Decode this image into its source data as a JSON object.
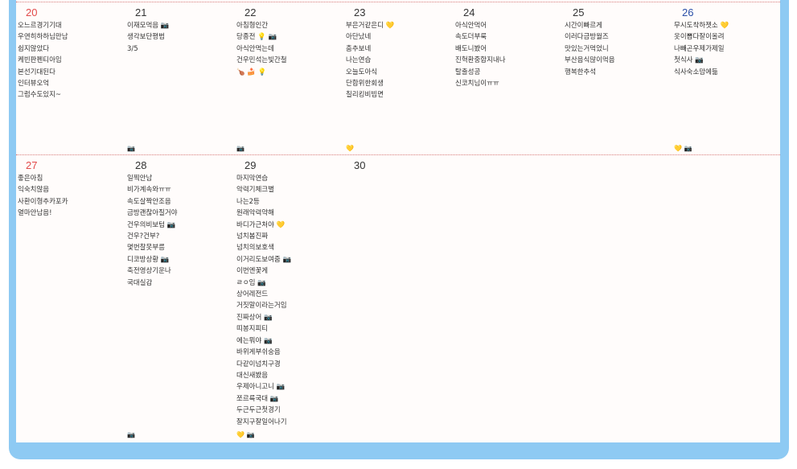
{
  "weeks": [
    {
      "days": [
        {
          "num": "20",
          "type": "sun",
          "entries": [
            "오느르경기기대",
            "우연히하하님만남",
            "쉽지않았다",
            "케빈판펜티아임",
            "본선기대된다",
            "인터뷰오억",
            "그럼수도있지~"
          ],
          "foot": []
        },
        {
          "num": "21",
          "type": "",
          "entries": [
            "이재모먹음 📷",
            "생각보단평범",
            "3/5"
          ],
          "foot": [
            "📷"
          ]
        },
        {
          "num": "22",
          "type": "",
          "entries": [
            "아침형인간",
            "당종전 💡 📷",
            "아식안먹는데",
            "건우민석는빛간철",
            "🍗 🍰 💡"
          ],
          "foot": [
            "📷"
          ]
        },
        {
          "num": "23",
          "type": "",
          "entries": [
            "부은거같은디 💛",
            "아단났네",
            "춤추보네",
            "나는연습",
            "오늘도아식",
            "단합위한회생",
            "칠리킹비빔면"
          ],
          "foot": [
            "💛"
          ]
        },
        {
          "num": "24",
          "type": "",
          "entries": [
            "아식안먹어",
            "속도더부룩",
            "배도니봤어",
            "진혁환중합지내나",
            "탈출성공",
            "신코치님이ㅠㅠ"
          ],
          "foot": []
        },
        {
          "num": "25",
          "type": "",
          "entries": [
            "시간이빠르게",
            "이러다금방월즈",
            "맛있는거먹었니",
            "부산음식많이먹음",
            "행복한추석"
          ],
          "foot": []
        },
        {
          "num": "26",
          "type": "sat",
          "entries": [
            "무시도착하젯소 💛",
            "옷이뽑다잘이올려",
            "나빼곤우제가제일",
            "첫식사 📷",
            "식사숙소맘에듦"
          ],
          "foot": [
            "💛 📷"
          ]
        }
      ]
    },
    {
      "days": [
        {
          "num": "27",
          "type": "sun",
          "entries": [
            "좋은아침",
            "익숙치않음",
            "사환이형추카포카",
            "열마안남음!"
          ],
          "foot": []
        },
        {
          "num": "28",
          "type": "",
          "entries": [
            "일찍안남",
            "비가계속와ㅠㅠ",
            "속도살짝안조음",
            "금방괜찮아질거야",
            "건우의비보텀 📷",
            "건우?건부?",
            "몇번찰못부름",
            "디코방상황 📷",
            "축전영상기운나",
            "국대실감"
          ],
          "foot": [
            "📷"
          ]
        },
        {
          "num": "29",
          "type": "",
          "entries": [
            "마지막연습",
            "악력기체크별",
            "나는2등",
            "원래악력약해",
            "바디가근처야 💛",
            "넘치봄진짜",
            "넘치의보호색",
            "이거리도보여줌 📷",
            "이번엔꽃게",
            "ㄹㅇ임 📷",
            "상어레전드",
            "거짓말이라는거임",
            "진짜상어 📷",
            "띠봉지피티",
            "에는뭐야 📷",
            "바위게부쉬숭음",
            "다같이넘치구경",
            "대신새봤음",
            "우제아니고니 📷",
            "쪼르륵국대 📷",
            "두근두근첫경기",
            "잘지구잘일어나기"
          ],
          "foot": [
            "💛 📷"
          ]
        },
        {
          "num": "30",
          "type": "",
          "entries": [],
          "foot": []
        }
      ]
    }
  ]
}
